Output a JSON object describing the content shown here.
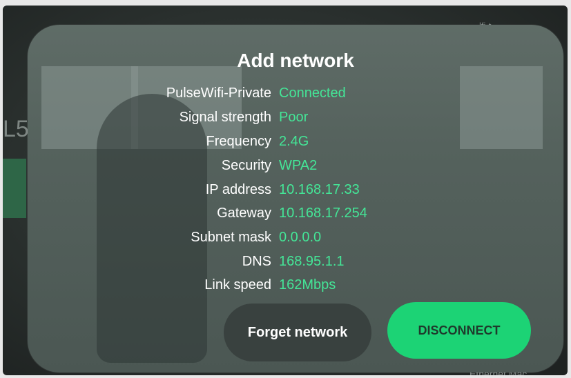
{
  "background": {
    "side_text": "L5",
    "top_text": "lfi-t",
    "corner_text": "Ethernet Mac"
  },
  "dialog": {
    "title": "Add network",
    "rows": [
      {
        "label": "PulseWifi-Private",
        "value": "Connected"
      },
      {
        "label": "Signal strength",
        "value": "Poor"
      },
      {
        "label": "Frequency",
        "value": "2.4G"
      },
      {
        "label": "Security",
        "value": "WPA2"
      },
      {
        "label": "IP address",
        "value": "10.168.17.33"
      },
      {
        "label": "Gateway",
        "value": "10.168.17.254"
      },
      {
        "label": "Subnet mask",
        "value": "0.0.0.0"
      },
      {
        "label": "DNS",
        "value": "168.95.1.1"
      },
      {
        "label": "Link speed",
        "value": "162Mbps"
      }
    ],
    "forget_label": "Forget network",
    "disconnect_label": "DISCONNECT"
  },
  "colors": {
    "accent": "#44e697",
    "button_green": "#1cd375",
    "button_dark": "#39413f"
  }
}
